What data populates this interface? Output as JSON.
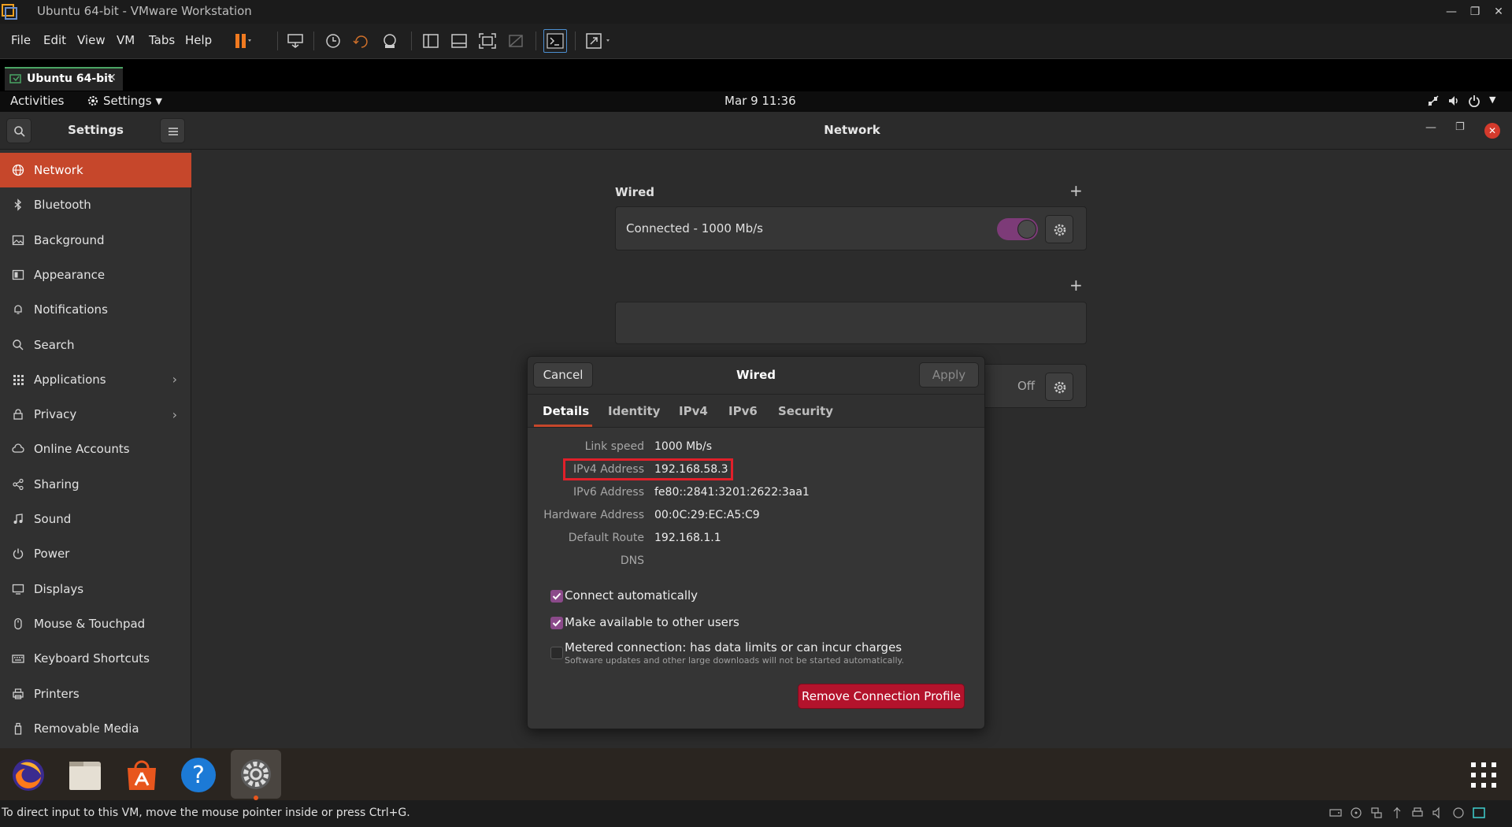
{
  "window": {
    "title": "Ubuntu 64-bit - VMware Workstation"
  },
  "menubar": {
    "items": [
      "File",
      "Edit",
      "View",
      "VM",
      "Tabs",
      "Help"
    ]
  },
  "vm_tab": {
    "label": "Ubuntu 64-bit"
  },
  "topbar": {
    "activities": "Activities",
    "app_menu": "Settings",
    "clock": "Mar 9  11:36"
  },
  "settings": {
    "title": "Settings",
    "page_title": "Network",
    "sidebar": [
      {
        "label": "Network",
        "icon": "network-icon",
        "active": true
      },
      {
        "label": "Bluetooth",
        "icon": "bluetooth-icon"
      },
      {
        "label": "Background",
        "icon": "background-icon"
      },
      {
        "label": "Appearance",
        "icon": "appearance-icon"
      },
      {
        "label": "Notifications",
        "icon": "bell-icon"
      },
      {
        "label": "Search",
        "icon": "search-icon"
      },
      {
        "label": "Applications",
        "icon": "grid-icon",
        "chevron": true
      },
      {
        "label": "Privacy",
        "icon": "lock-icon",
        "chevron": true
      },
      {
        "label": "Online Accounts",
        "icon": "cloud-icon"
      },
      {
        "label": "Sharing",
        "icon": "share-icon"
      },
      {
        "label": "Sound",
        "icon": "music-note-icon"
      },
      {
        "label": "Power",
        "icon": "power-icon"
      },
      {
        "label": "Displays",
        "icon": "display-icon"
      },
      {
        "label": "Mouse & Touchpad",
        "icon": "mouse-icon"
      },
      {
        "label": "Keyboard Shortcuts",
        "icon": "keyboard-icon"
      },
      {
        "label": "Printers",
        "icon": "printer-icon"
      },
      {
        "label": "Removable Media",
        "icon": "usb-icon"
      }
    ]
  },
  "network": {
    "wired_heading": "Wired",
    "wired_status": "Connected - 1000 Mb/s",
    "off_label": "Off"
  },
  "dialog": {
    "title": "Wired",
    "cancel": "Cancel",
    "apply": "Apply",
    "tabs": [
      "Details",
      "Identity",
      "IPv4",
      "IPv6",
      "Security"
    ],
    "details": [
      {
        "label": "Link speed",
        "value": "1000 Mb/s"
      },
      {
        "label": "IPv4 Address",
        "value": "192.168.58.3"
      },
      {
        "label": "IPv6 Address",
        "value": "fe80::2841:3201:2622:3aa1"
      },
      {
        "label": "Hardware Address",
        "value": "00:0C:29:EC:A5:C9"
      },
      {
        "label": "Default Route",
        "value": "192.168.1.1"
      },
      {
        "label": "DNS",
        "value": ""
      }
    ],
    "connect_auto": "Connect automatically",
    "available_users": "Make available to other users",
    "metered": "Metered connection: has data limits or can incur charges",
    "metered_sub": "Software updates and other large downloads will not be started automatically.",
    "remove": "Remove Connection Profile"
  },
  "statusbar": {
    "text": "To direct input to this VM, move the mouse pointer inside or press Ctrl+G."
  },
  "colors": {
    "accent": "#c6472b",
    "danger": "#b3132c",
    "highlight": "#e0202a",
    "check": "#8b4a8a"
  }
}
